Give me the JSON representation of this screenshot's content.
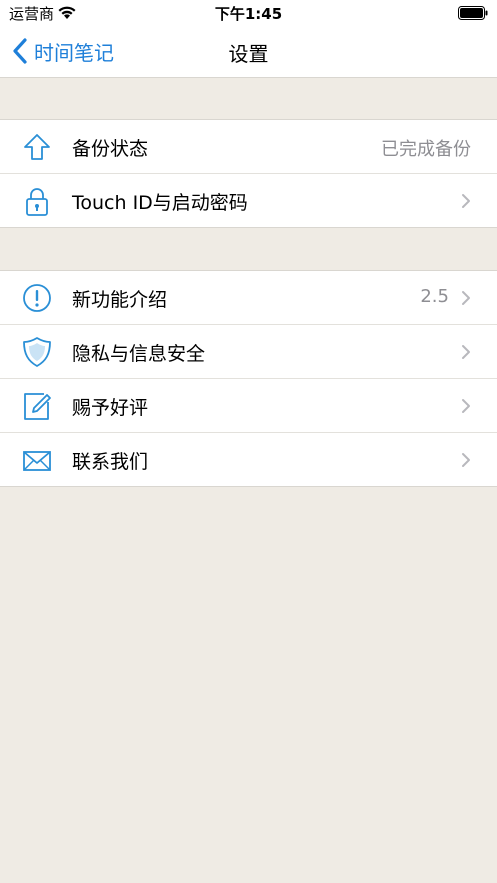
{
  "status_bar": {
    "carrier": "运营商",
    "time": "下午1:45"
  },
  "nav": {
    "back_label": "时间笔记",
    "title": "设置"
  },
  "groups": [
    {
      "rows": [
        {
          "label": "备份状态",
          "value": "已完成备份",
          "icon": "cloud-upload-icon"
        },
        {
          "label": "Touch ID与启动密码",
          "icon": "lock-icon"
        }
      ]
    },
    {
      "rows": [
        {
          "label": "新功能介绍",
          "value": "2.5",
          "icon": "info-exclamation-icon"
        },
        {
          "label": "隐私与信息安全",
          "icon": "shield-icon"
        },
        {
          "label": "赐予好评",
          "icon": "edit-icon"
        },
        {
          "label": "联系我们",
          "icon": "mail-icon"
        }
      ]
    }
  ],
  "colors": {
    "accent": "#1e7fd9",
    "icon": "#2a8fd6",
    "background": "#efebe4"
  }
}
